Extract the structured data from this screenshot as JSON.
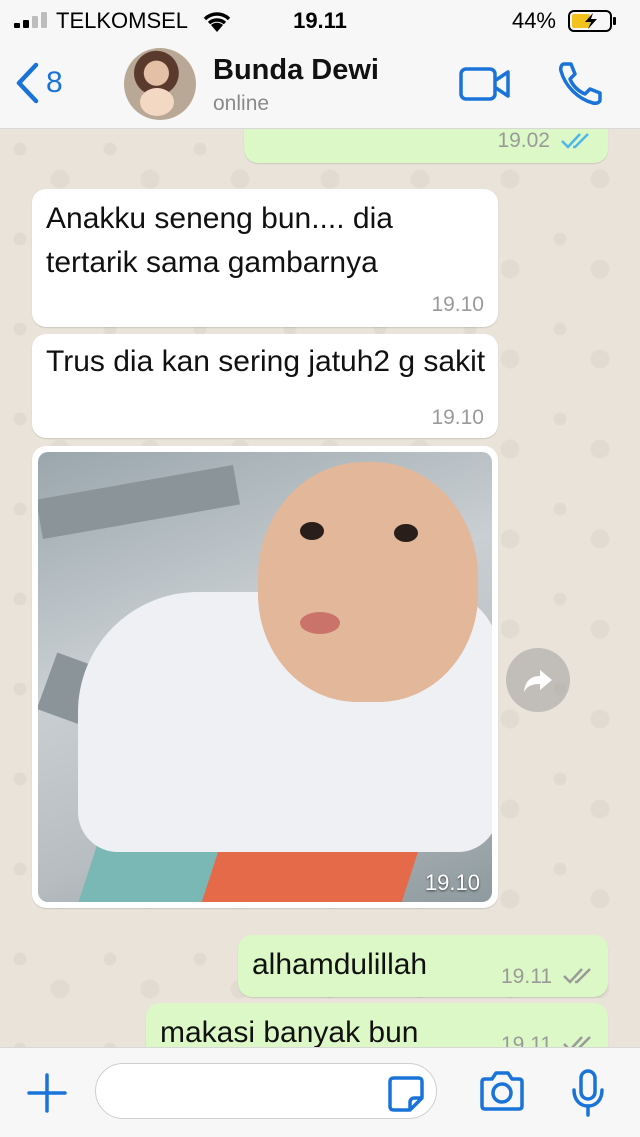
{
  "status_bar": {
    "carrier": "TELKOMSEL",
    "time": "19.11",
    "battery": "44%"
  },
  "header": {
    "back_count": "8",
    "contact_name": "Bunda Dewi",
    "contact_status": "online"
  },
  "messages": [
    {
      "direction": "out",
      "text": "",
      "time": "19.02",
      "read": true
    },
    {
      "direction": "in",
      "text": "Anakku seneng bun.... dia tertarik sama gambarnya",
      "time": "19.10"
    },
    {
      "direction": "in",
      "text": "Trus dia kan sering jatuh2 g sakit",
      "time": "19.10"
    },
    {
      "direction": "in",
      "type": "photo",
      "time": "19.10"
    },
    {
      "direction": "out",
      "text": "alhamdulillah",
      "time": "19.11",
      "read": false
    },
    {
      "direction": "out",
      "text": "makasi banyak bun",
      "time": "19.11",
      "read": false
    }
  ],
  "input": {
    "placeholder": ""
  },
  "colors": {
    "accent": "#1a73d9",
    "outgoing_bubble": "#dcf8c6",
    "incoming_bubble": "#ffffff",
    "chat_background": "#e9e3d9",
    "read_ticks": "#4fb6ec"
  }
}
